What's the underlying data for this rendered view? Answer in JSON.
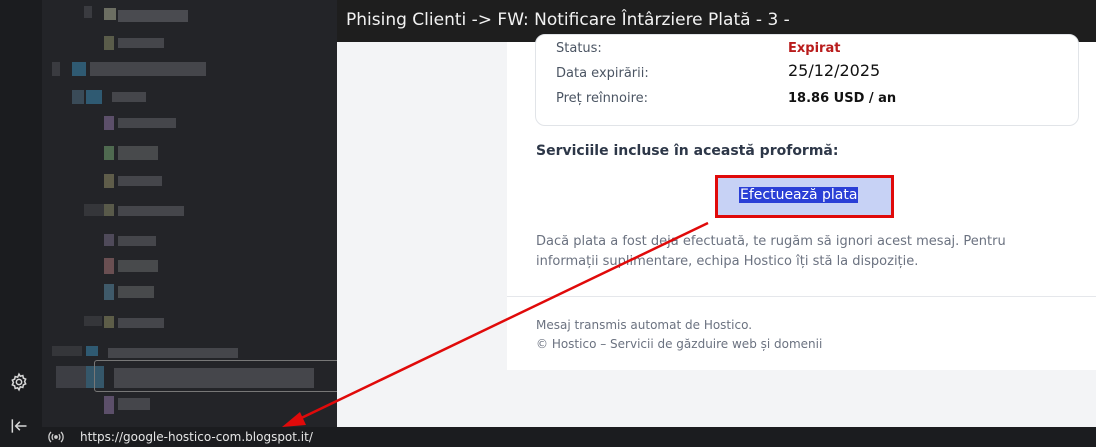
{
  "header": {
    "title": "Phising Clienti -> FW: Notificare Întârziere Plată - 3 -"
  },
  "details": [
    {
      "label": "Status:",
      "value": "Expirat",
      "style": "red"
    },
    {
      "label": "Data expirării:",
      "value": "25/12/2025",
      "style": "date"
    },
    {
      "label": "Preț reînnoire:",
      "value": "18.86 USD / an",
      "style": "bold"
    }
  ],
  "services_heading": "Serviciile incluse în această proformă:",
  "pay_button": "Efectuează plata",
  "note": "Dacă plata a fost deja efectuată, te rugăm să ignori acest mesaj. Pentru informații suplimentare, echipa Hostico îți stă la dispoziție.",
  "footer": {
    "line1": "Mesaj transmis automat de Hostico.",
    "line2": "© Hostico – Servicii de găzduire web și domenii"
  },
  "statusbar": {
    "url": "https://google-hostico-com.blogspot.it/"
  },
  "icons": {
    "settings": "gear-icon",
    "collapse": "collapse-sidebar-icon",
    "link": "broadcast-icon"
  },
  "colors": {
    "highlight_border": "#e00a0a",
    "status_expired": "#b91c1c",
    "arrow": "#e00a0a"
  }
}
